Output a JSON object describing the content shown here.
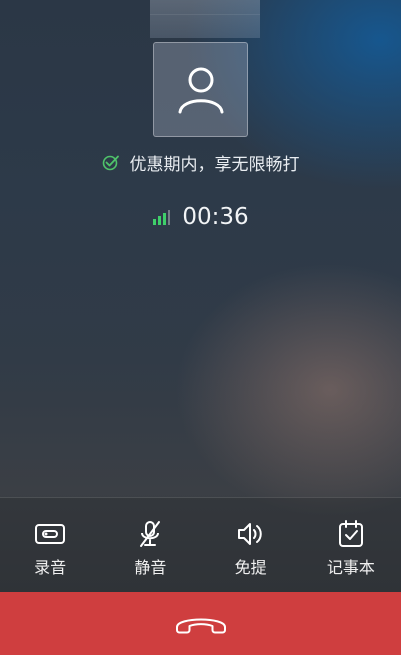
{
  "call": {
    "promo_text": "优惠期内，享无限畅打",
    "duration": "00:36"
  },
  "actions": [
    {
      "label": "录音",
      "icon": "record-icon"
    },
    {
      "label": "静音",
      "icon": "mute-icon"
    },
    {
      "label": "免提",
      "icon": "speaker-icon"
    },
    {
      "label": "记事本",
      "icon": "notepad-icon"
    }
  ],
  "hangup": {
    "icon": "hang-up-icon"
  },
  "colors": {
    "hangup_bg": "#cf3e3f",
    "promo_check": "#4fc36a",
    "signal": "#3fcf6a"
  }
}
